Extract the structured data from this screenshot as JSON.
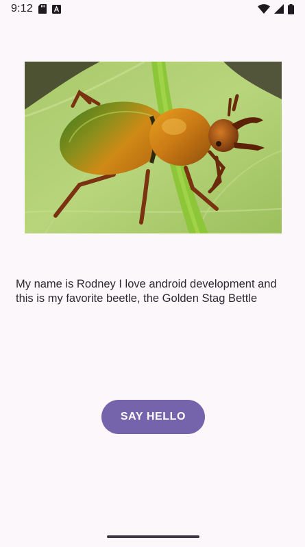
{
  "status_bar": {
    "time": "9:12",
    "left_icons": [
      "sd-card-icon",
      "app-notification-icon"
    ],
    "right_icons": [
      "wifi-icon",
      "signal-icon",
      "battery-icon"
    ]
  },
  "main": {
    "image_subject": "golden-stag-beetle-photo",
    "description": "My name is Rodney I love android development and this is my favorite beetle, the Golden Stag Bettle",
    "button_label": "SAY HELLO"
  },
  "colors": {
    "background": "#fcf7fb",
    "button": "#7563ac",
    "button_text": "#ffffff",
    "text": "#2b292f"
  }
}
